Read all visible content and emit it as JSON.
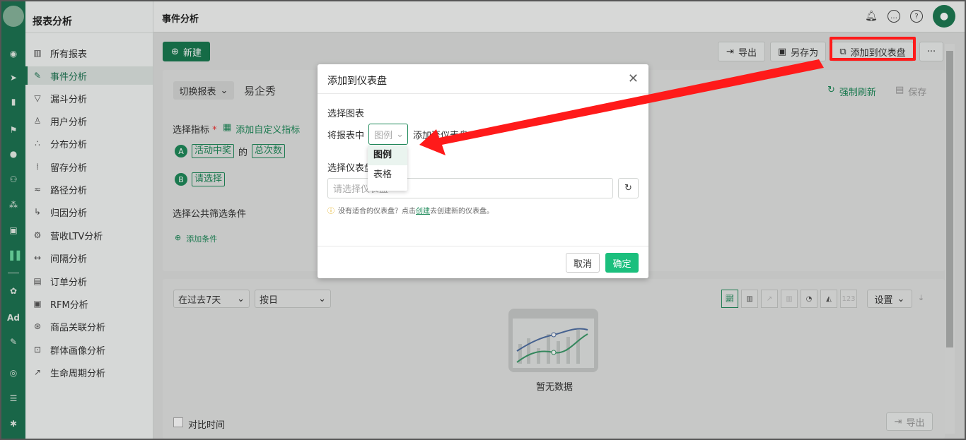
{
  "app": {
    "section_title": "报表分析",
    "page_title": "事件分析"
  },
  "sidebar": {
    "items": [
      {
        "label": "所有报表",
        "icon": "bar-chart-icon"
      },
      {
        "label": "事件分析",
        "icon": "edit-chart-icon",
        "active": true
      },
      {
        "label": "漏斗分析",
        "icon": "funnel-icon"
      },
      {
        "label": "用户分析",
        "icon": "user-icon"
      },
      {
        "label": "分布分析",
        "icon": "distribution-icon"
      },
      {
        "label": "留存分析",
        "icon": "dots-icon"
      },
      {
        "label": "路径分析",
        "icon": "path-icon"
      },
      {
        "label": "归因分析",
        "icon": "attribution-icon"
      },
      {
        "label": "营收LTV分析",
        "icon": "revenue-icon"
      },
      {
        "label": "间隔分析",
        "icon": "interval-icon"
      },
      {
        "label": "订单分析",
        "icon": "order-icon"
      },
      {
        "label": "RFM分析",
        "icon": "rfm-icon"
      },
      {
        "label": "商品关联分析",
        "icon": "product-link-icon"
      },
      {
        "label": "群体画像分析",
        "icon": "persona-icon"
      },
      {
        "label": "生命周期分析",
        "icon": "lifecycle-icon"
      }
    ]
  },
  "rail": {
    "ad_label": "Ad"
  },
  "toolbar": {
    "new_label": "新建",
    "export_label": "导出",
    "save_as_label": "另存为",
    "add_dashboard_label": "添加到仪表盘",
    "more_label": "···"
  },
  "report": {
    "switch_label": "切换报表",
    "report_name": "易企秀",
    "force_refresh": "强制刷新",
    "save_label": "保存",
    "metric_label": "选择指标",
    "required_mark": "*",
    "add_custom_metric": "添加自定义指标",
    "metric_a": {
      "badge": "A",
      "event": "活动中奖",
      "of": "的",
      "measure": "总次数"
    },
    "metric_b": {
      "badge": "B",
      "placeholder": "请选择"
    },
    "filter_label": "选择公共筛选条件",
    "add_condition": "添加条件"
  },
  "chart_area": {
    "date_range": "在过去7天",
    "granularity": "按日",
    "settings_label": "设置",
    "type_123": "123",
    "empty_text": "暂无数据",
    "compare_label": "对比时间",
    "export_label": "导出"
  },
  "modal": {
    "title": "添加到仪表盘",
    "choose_chart": "选择图表",
    "prefix": "将报表中",
    "chart_select_value": "图例",
    "suffix": "添加至仪表盘",
    "dropdown_options": [
      "图例",
      "表格"
    ],
    "choose_dashboard": "选择仪表盘",
    "dashboard_placeholder": "请选择仪表盘",
    "hint_before": "没有适合的仪表盘？点击",
    "hint_link": "创建",
    "hint_after": "去创建新的仪表盘。",
    "cancel": "取消",
    "confirm": "确定"
  },
  "colors": {
    "brand": "#197a50",
    "accent_red": "#ff1a1a"
  }
}
